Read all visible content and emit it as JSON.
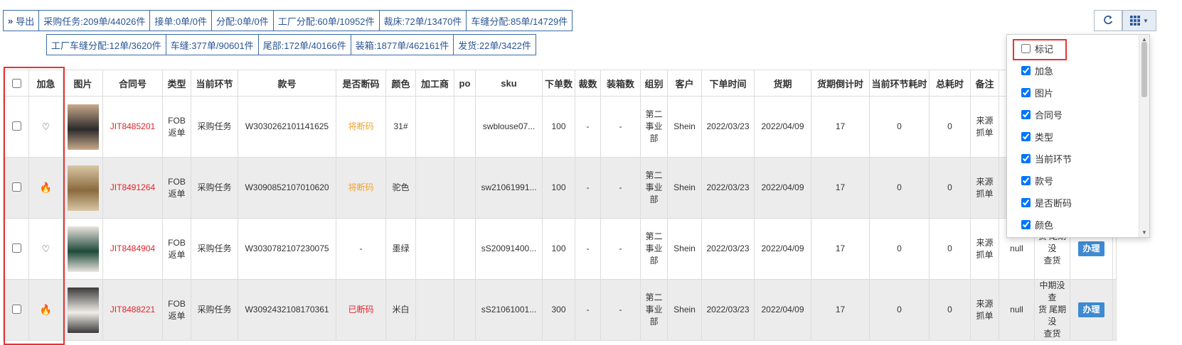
{
  "toolbar": {
    "export_label": "导出",
    "row1": [
      "采购任务:209单/44026件",
      "接单:0单/0件",
      "分配:0单/0件",
      "工厂分配:60单/10952件",
      "裁床:72单/13470件",
      "车缝分配:85单/14729件"
    ],
    "row2": [
      "工厂车缝分配:12单/3620件",
      "车缝:377单/90601件",
      "尾部:172单/40166件",
      "装箱:1877单/462161件",
      "发货:22单/3422件"
    ]
  },
  "tools": {
    "refresh_icon": "refresh-icon",
    "columns_icon": "grid-icon"
  },
  "table": {
    "headers": [
      "加急",
      "图片",
      "合同号",
      "类型",
      "当前环节",
      "款号",
      "是否断码",
      "颜色",
      "加工商",
      "po",
      "sku",
      "下单数",
      "裁数",
      "装箱数",
      "组别",
      "客户",
      "下单时间",
      "货期",
      "货期倒计时",
      "当前环节耗时",
      "总耗时",
      "备注"
    ],
    "rows": [
      {
        "urgent": "heart",
        "contract": "JIT8485201",
        "type": "FOB\n返单",
        "stage": "采购任务",
        "style": "W3030262101141625",
        "broken": "将断码",
        "broken_color": "orange",
        "color": "31#",
        "processor": "",
        "po": "",
        "sku": "swblouse07...",
        "qty": "100",
        "cut": "-",
        "boxed": "-",
        "group": "第二\n事业\n部",
        "customer": "Shein",
        "order_time": "2022/03/23",
        "delivery": "2022/04/09",
        "countdown": "17",
        "stage_time": "0",
        "total_time": "0",
        "remark": "来源\n抓单",
        "img_colors": [
          "#2b2b2b",
          "#c9a98a"
        ]
      },
      {
        "urgent": "fire",
        "contract": "JIT8491264",
        "type": "FOB\n返单",
        "stage": "采购任务",
        "style": "W3090852107010620",
        "broken": "将断码",
        "broken_color": "orange",
        "color": "驼色",
        "processor": "",
        "po": "",
        "sku": "sw21061991...",
        "qty": "100",
        "cut": "-",
        "boxed": "-",
        "group": "第二\n事业\n部",
        "customer": "Shein",
        "order_time": "2022/03/23",
        "delivery": "2022/04/09",
        "countdown": "17",
        "stage_time": "0",
        "total_time": "0",
        "remark": "来源\n抓单",
        "img_colors": [
          "#8b6a3e",
          "#d8c7a5"
        ]
      },
      {
        "urgent": "heart",
        "contract": "JIT8484904",
        "type": "FOB\n返单",
        "stage": "采购任务",
        "style": "W3030782107230075",
        "broken": "-",
        "broken_color": "normal",
        "color": "墨绿",
        "processor": "",
        "po": "",
        "sku": "sS20091400...",
        "qty": "100",
        "cut": "-",
        "boxed": "-",
        "group": "第二\n事业\n部",
        "customer": "Shein",
        "order_time": "2022/03/23",
        "delivery": "2022/04/09",
        "countdown": "17",
        "stage_time": "0",
        "total_time": "0",
        "remark": "来源\n抓单",
        "img_colors": [
          "#1f4a3a",
          "#e9e4df"
        ]
      },
      {
        "urgent": "fire",
        "contract": "JIT8488221",
        "type": "FOB\n返单",
        "stage": "采购任务",
        "style": "W3092432108170361",
        "broken": "已断码",
        "broken_color": "red",
        "color": "米白",
        "processor": "",
        "po": "",
        "sku": "sS21061001...",
        "qty": "300",
        "cut": "-",
        "boxed": "-",
        "group": "第二\n事业\n部",
        "customer": "Shein",
        "order_time": "2022/03/23",
        "delivery": "2022/04/09",
        "countdown": "17",
        "stage_time": "0",
        "total_time": "0",
        "remark": "来源\n抓单",
        "img_colors": [
          "#f1eee8",
          "#3a3a3a"
        ]
      }
    ],
    "partial_col": {
      "row3": "null",
      "row4": "null"
    },
    "partial_col2": {
      "row3": "货 尾期没\n查货",
      "row4": "中期没查\n货 尾期没\n查货"
    },
    "action_label": "办理"
  },
  "column_menu": {
    "items": [
      {
        "label": "标记",
        "checked": false
      },
      {
        "label": "加急",
        "checked": true
      },
      {
        "label": "图片",
        "checked": true
      },
      {
        "label": "合同号",
        "checked": true
      },
      {
        "label": "类型",
        "checked": true
      },
      {
        "label": "当前环节",
        "checked": true
      },
      {
        "label": "款号",
        "checked": true
      },
      {
        "label": "是否断码",
        "checked": true
      },
      {
        "label": "颜色",
        "checked": true
      }
    ]
  },
  "colors": {
    "primary": "#2a5595",
    "highlight": "#e53333",
    "contract": "#e0252c",
    "warning": "#f0a22a"
  }
}
